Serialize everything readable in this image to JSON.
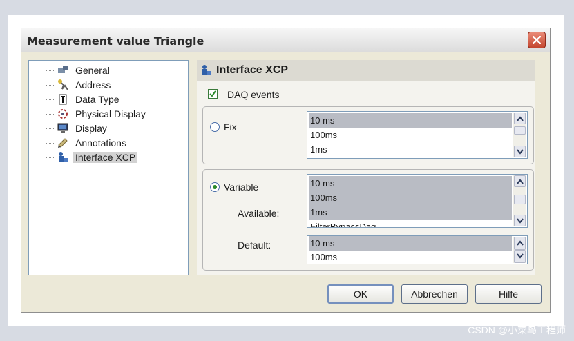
{
  "window": {
    "title": "Measurement value Triangle",
    "accent_close": "#c4462f"
  },
  "tree": {
    "items": [
      {
        "label": "General",
        "icon": "general-icon",
        "selected": false
      },
      {
        "label": "Address",
        "icon": "address-icon",
        "selected": false
      },
      {
        "label": "Data Type",
        "icon": "data-type-icon",
        "selected": false
      },
      {
        "label": "Physical Display",
        "icon": "physical-display-icon",
        "selected": false
      },
      {
        "label": "Display",
        "icon": "display-icon",
        "selected": false
      },
      {
        "label": "Annotations",
        "icon": "annotations-icon",
        "selected": false
      },
      {
        "label": "Interface XCP",
        "icon": "interface-xcp-icon",
        "selected": true
      }
    ]
  },
  "panel": {
    "title": "Interface XCP",
    "daq_events_label": "DAQ events",
    "daq_events_checked": true,
    "fix": {
      "label": "Fix",
      "selected": false,
      "options": [
        "10 ms",
        "100ms",
        "1ms"
      ]
    },
    "variable": {
      "label": "Variable",
      "selected": true,
      "available_label": "Available:",
      "available_options": [
        "10 ms",
        "100ms",
        "1ms",
        "FilterBypassDaq"
      ],
      "default_label": "Default:",
      "default_options": [
        "10 ms",
        "100ms"
      ]
    }
  },
  "buttons": {
    "ok": "OK",
    "cancel": "Abbrechen",
    "help": "Hilfe"
  },
  "watermark": "CSDN @小菜鸟工程师"
}
